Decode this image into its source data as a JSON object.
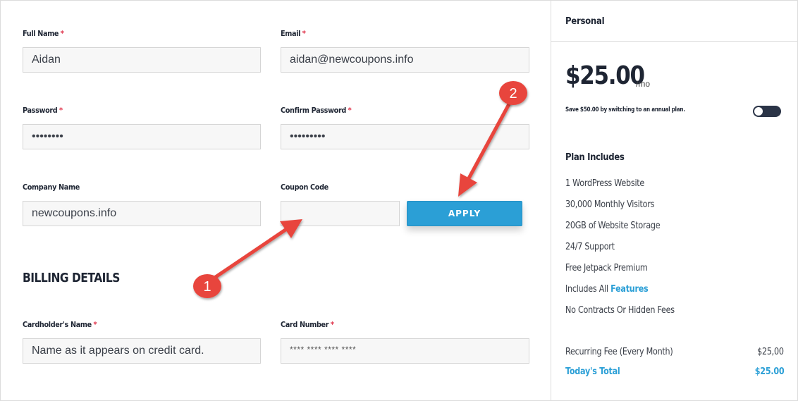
{
  "form": {
    "full_name": {
      "label": "Full Name",
      "value": "Aidan"
    },
    "email": {
      "label": "Email",
      "value": "aidan@newcoupons.info"
    },
    "password": {
      "label": "Password",
      "value": "••••••••"
    },
    "confirm_password": {
      "label": "Confirm Password",
      "value": "•••••••••"
    },
    "company_name": {
      "label": "Company Name",
      "value": "newcoupons.info"
    },
    "coupon_code": {
      "label": "Coupon Code",
      "value": ""
    },
    "apply_label": "APPLY",
    "required_mark": "*"
  },
  "billing": {
    "heading": "BILLING DETAILS",
    "cardholder": {
      "label": "Cardholder's Name",
      "placeholder": "Name as it appears on credit card."
    },
    "card_number": {
      "label": "Card Number",
      "placeholder": "**** **** **** ****"
    }
  },
  "sidebar": {
    "plan_name": "Personal",
    "price": "$25.00",
    "period": "/mo",
    "save_note": "Save $50.00 by switching to an annual plan.",
    "plan_includes_heading": "Plan Includes",
    "features": [
      "1 WordPress Website",
      "30,000 Monthly Visitors",
      "20GB of Website Storage",
      "24/7 Support",
      "Free Jetpack Premium",
      "Includes All",
      "No Contracts Or Hidden Fees"
    ],
    "features_link": "Features",
    "recurring_fee_label": "Recurring Fee (Every Month)",
    "recurring_fee_value": "$25,00",
    "total_label": "Today's Total",
    "total_value": "$25.00"
  },
  "annotations": {
    "badge_1": "1",
    "badge_2": "2"
  },
  "colors": {
    "accent": "#2b9fd6",
    "required": "#e0334a",
    "annotation_red": "#e8453c",
    "toggle": "#2b3447"
  }
}
